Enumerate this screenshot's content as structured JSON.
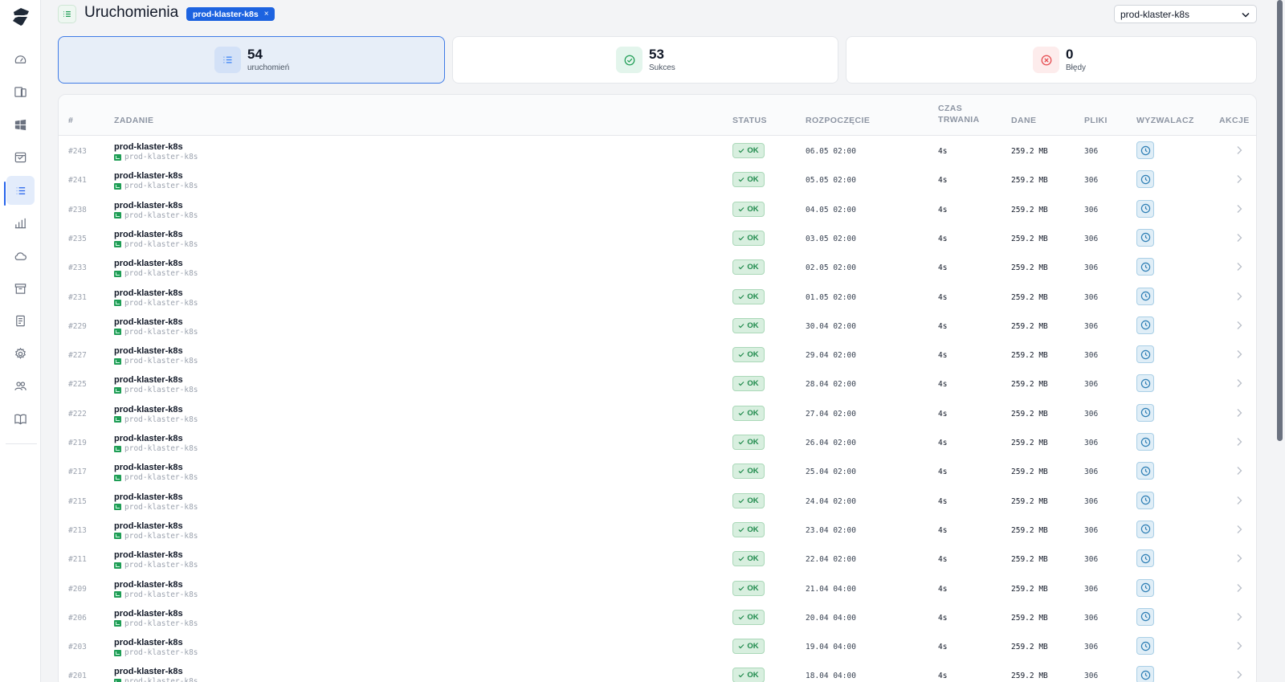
{
  "page": {
    "title": "Uruchomienia",
    "filter_chip": "prod-klaster-k8s",
    "filter_chip_close": "×"
  },
  "cluster_select": {
    "value": "prod-klaster-k8s"
  },
  "stats": {
    "runs": {
      "value": "54",
      "label": "uruchomień"
    },
    "success": {
      "value": "53",
      "label": "Sukces"
    },
    "errors": {
      "value": "0",
      "label": "Błędy"
    }
  },
  "table": {
    "headers": {
      "num": "#",
      "task": "ZADANIE",
      "status": "STATUS",
      "start": "ROZPOCZĘCIE",
      "duration_1": "CZAS",
      "duration_2": "TRWANIA",
      "data": "DANE",
      "files": "PLIKI",
      "trigger": "WYZWALACZ",
      "actions": "AKCJE"
    },
    "rows": [
      {
        "num": "#243",
        "name": "prod-klaster-k8s",
        "sub": "prod-klaster-k8s",
        "status": "OK",
        "start": "06.05 02:00",
        "duration": "4s",
        "data": "259.2 MB",
        "files": "306"
      },
      {
        "num": "#241",
        "name": "prod-klaster-k8s",
        "sub": "prod-klaster-k8s",
        "status": "OK",
        "start": "05.05 02:00",
        "duration": "4s",
        "data": "259.2 MB",
        "files": "306"
      },
      {
        "num": "#238",
        "name": "prod-klaster-k8s",
        "sub": "prod-klaster-k8s",
        "status": "OK",
        "start": "04.05 02:00",
        "duration": "4s",
        "data": "259.2 MB",
        "files": "306"
      },
      {
        "num": "#235",
        "name": "prod-klaster-k8s",
        "sub": "prod-klaster-k8s",
        "status": "OK",
        "start": "03.05 02:00",
        "duration": "4s",
        "data": "259.2 MB",
        "files": "306"
      },
      {
        "num": "#233",
        "name": "prod-klaster-k8s",
        "sub": "prod-klaster-k8s",
        "status": "OK",
        "start": "02.05 02:00",
        "duration": "4s",
        "data": "259.2 MB",
        "files": "306"
      },
      {
        "num": "#231",
        "name": "prod-klaster-k8s",
        "sub": "prod-klaster-k8s",
        "status": "OK",
        "start": "01.05 02:00",
        "duration": "4s",
        "data": "259.2 MB",
        "files": "306"
      },
      {
        "num": "#229",
        "name": "prod-klaster-k8s",
        "sub": "prod-klaster-k8s",
        "status": "OK",
        "start": "30.04 02:00",
        "duration": "4s",
        "data": "259.2 MB",
        "files": "306"
      },
      {
        "num": "#227",
        "name": "prod-klaster-k8s",
        "sub": "prod-klaster-k8s",
        "status": "OK",
        "start": "29.04 02:00",
        "duration": "4s",
        "data": "259.2 MB",
        "files": "306"
      },
      {
        "num": "#225",
        "name": "prod-klaster-k8s",
        "sub": "prod-klaster-k8s",
        "status": "OK",
        "start": "28.04 02:00",
        "duration": "4s",
        "data": "259.2 MB",
        "files": "306"
      },
      {
        "num": "#222",
        "name": "prod-klaster-k8s",
        "sub": "prod-klaster-k8s",
        "status": "OK",
        "start": "27.04 02:00",
        "duration": "4s",
        "data": "259.2 MB",
        "files": "306"
      },
      {
        "num": "#219",
        "name": "prod-klaster-k8s",
        "sub": "prod-klaster-k8s",
        "status": "OK",
        "start": "26.04 02:00",
        "duration": "4s",
        "data": "259.2 MB",
        "files": "306"
      },
      {
        "num": "#217",
        "name": "prod-klaster-k8s",
        "sub": "prod-klaster-k8s",
        "status": "OK",
        "start": "25.04 02:00",
        "duration": "4s",
        "data": "259.2 MB",
        "files": "306"
      },
      {
        "num": "#215",
        "name": "prod-klaster-k8s",
        "sub": "prod-klaster-k8s",
        "status": "OK",
        "start": "24.04 02:00",
        "duration": "4s",
        "data": "259.2 MB",
        "files": "306"
      },
      {
        "num": "#213",
        "name": "prod-klaster-k8s",
        "sub": "prod-klaster-k8s",
        "status": "OK",
        "start": "23.04 02:00",
        "duration": "4s",
        "data": "259.2 MB",
        "files": "306"
      },
      {
        "num": "#211",
        "name": "prod-klaster-k8s",
        "sub": "prod-klaster-k8s",
        "status": "OK",
        "start": "22.04 02:00",
        "duration": "4s",
        "data": "259.2 MB",
        "files": "306"
      },
      {
        "num": "#209",
        "name": "prod-klaster-k8s",
        "sub": "prod-klaster-k8s",
        "status": "OK",
        "start": "21.04 04:00",
        "duration": "4s",
        "data": "259.2 MB",
        "files": "306"
      },
      {
        "num": "#206",
        "name": "prod-klaster-k8s",
        "sub": "prod-klaster-k8s",
        "status": "OK",
        "start": "20.04 04:00",
        "duration": "4s",
        "data": "259.2 MB",
        "files": "306"
      },
      {
        "num": "#203",
        "name": "prod-klaster-k8s",
        "sub": "prod-klaster-k8s",
        "status": "OK",
        "start": "19.04 04:00",
        "duration": "4s",
        "data": "259.2 MB",
        "files": "306"
      },
      {
        "num": "#201",
        "name": "prod-klaster-k8s",
        "sub": "prod-klaster-k8s",
        "status": "OK",
        "start": "18.04 04:00",
        "duration": "4s",
        "data": "259.2 MB",
        "files": "306"
      }
    ]
  },
  "sidebar": {
    "items": [
      {
        "icon": "gauge-icon"
      },
      {
        "icon": "devices-icon"
      },
      {
        "icon": "windows-icon"
      },
      {
        "icon": "calendar-check-icon"
      },
      {
        "icon": "list-icon",
        "active": true
      },
      {
        "icon": "bar-chart-icon"
      },
      {
        "icon": "cloud-icon"
      },
      {
        "icon": "archive-icon"
      },
      {
        "icon": "document-icon"
      },
      {
        "icon": "gear-icon"
      },
      {
        "icon": "users-icon"
      },
      {
        "icon": "book-icon"
      }
    ]
  },
  "colors": {
    "accent": "#2563eb",
    "success": "#1f8a4c",
    "danger": "#e5484d",
    "chip": "#1d63e0"
  }
}
